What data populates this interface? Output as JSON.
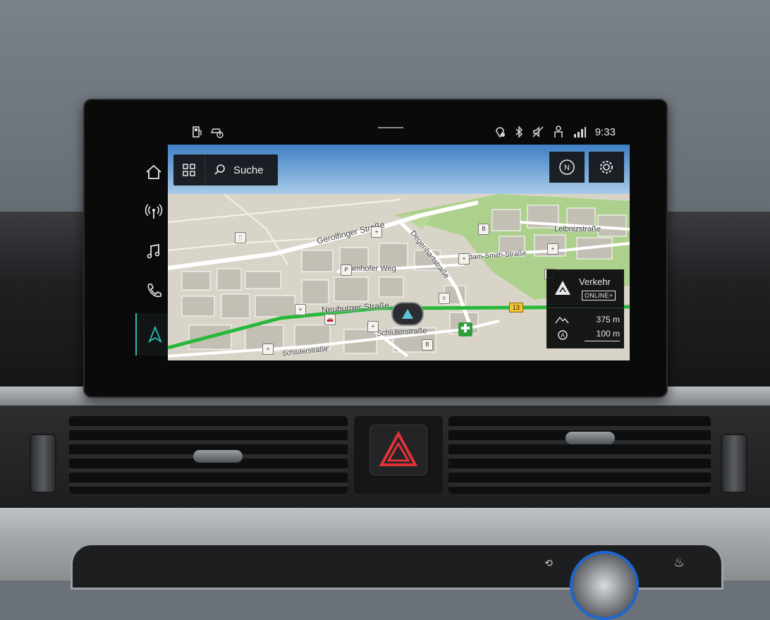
{
  "status_bar": {
    "time": "9:33",
    "icons_left": [
      "fuel-icon",
      "car-service-icon"
    ],
    "icons_right": [
      "location-icon",
      "bluetooth-icon",
      "mute-icon",
      "person-icon",
      "lte-signal-icon"
    ]
  },
  "sidebar": {
    "items": [
      {
        "name": "home",
        "icon": "home-icon"
      },
      {
        "name": "radio",
        "icon": "radio-icon"
      },
      {
        "name": "media",
        "icon": "music-icon"
      },
      {
        "name": "phone",
        "icon": "phone-icon"
      },
      {
        "name": "navigation",
        "icon": "navigation-icon",
        "active": true
      }
    ]
  },
  "toolbar": {
    "menu_icon": "grid-icon",
    "search_label": "Suche",
    "search_icon": "search-icon",
    "compass_icon": "north-compass-icon",
    "settings_icon": "gear-icon"
  },
  "traffic": {
    "title": "Verkehr",
    "badge": "ONLINE+",
    "elevation_value": "375 m",
    "scale_value": "100 m"
  },
  "map": {
    "streets": [
      "Gerolfinger Straße",
      "Degenhartstraße",
      "Leibnizstraße",
      "Adam-Smith-Straße",
      "amhofer Weg",
      "Neuburger Straße",
      "Schlüterstraße",
      "Schlüterstraße"
    ],
    "route_number": "13",
    "colors": {
      "route": "#27b83a",
      "green_area": "#a9cf86",
      "roads": "#ffffff",
      "sky": "#6ea6d8"
    }
  }
}
